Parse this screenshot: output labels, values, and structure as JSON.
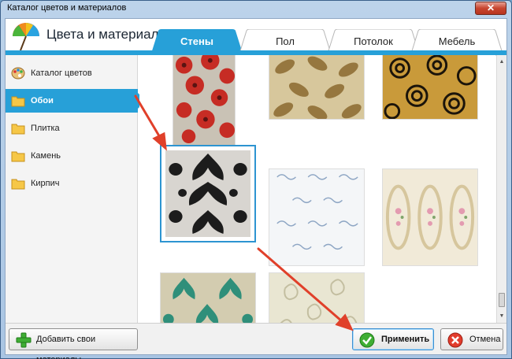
{
  "window": {
    "title": "Каталог цветов и материалов",
    "close_glyph": "✕"
  },
  "header": {
    "title": "Цвета и материалы",
    "icon": "umbrella-icon"
  },
  "tabs": [
    {
      "label": "Стены",
      "active": true
    },
    {
      "label": "Пол",
      "active": false
    },
    {
      "label": "Потолок",
      "active": false
    },
    {
      "label": "Мебель",
      "active": false
    }
  ],
  "sidebar": {
    "items": [
      {
        "label": "Каталог цветов",
        "icon": "palette-icon",
        "active": false
      },
      {
        "label": "Обои",
        "icon": "folder-icon",
        "active": true
      },
      {
        "label": "Плитка",
        "icon": "folder-icon",
        "active": false
      },
      {
        "label": "Камень",
        "icon": "folder-icon",
        "active": false
      },
      {
        "label": "Кирпич",
        "icon": "folder-icon",
        "active": false
      }
    ]
  },
  "gallery": {
    "tiles": [
      {
        "pattern": "red-poppies",
        "selected": false
      },
      {
        "pattern": "gold-leaves",
        "selected": false
      },
      {
        "pattern": "black-gold-swirls",
        "selected": false
      },
      {
        "pattern": "black-damask",
        "selected": true
      },
      {
        "pattern": "blue-ornament",
        "selected": false
      },
      {
        "pattern": "floral-medallion",
        "selected": false
      },
      {
        "pattern": "green-damask",
        "selected": false
      },
      {
        "pattern": "beige-paisley",
        "selected": false
      }
    ]
  },
  "footer": {
    "add_label": "Добавить свои материалы",
    "apply_label": "Применить",
    "cancel_label": "Отмена"
  },
  "colors": {
    "accent": "#27a0d8",
    "arrow": "#e0402a"
  }
}
